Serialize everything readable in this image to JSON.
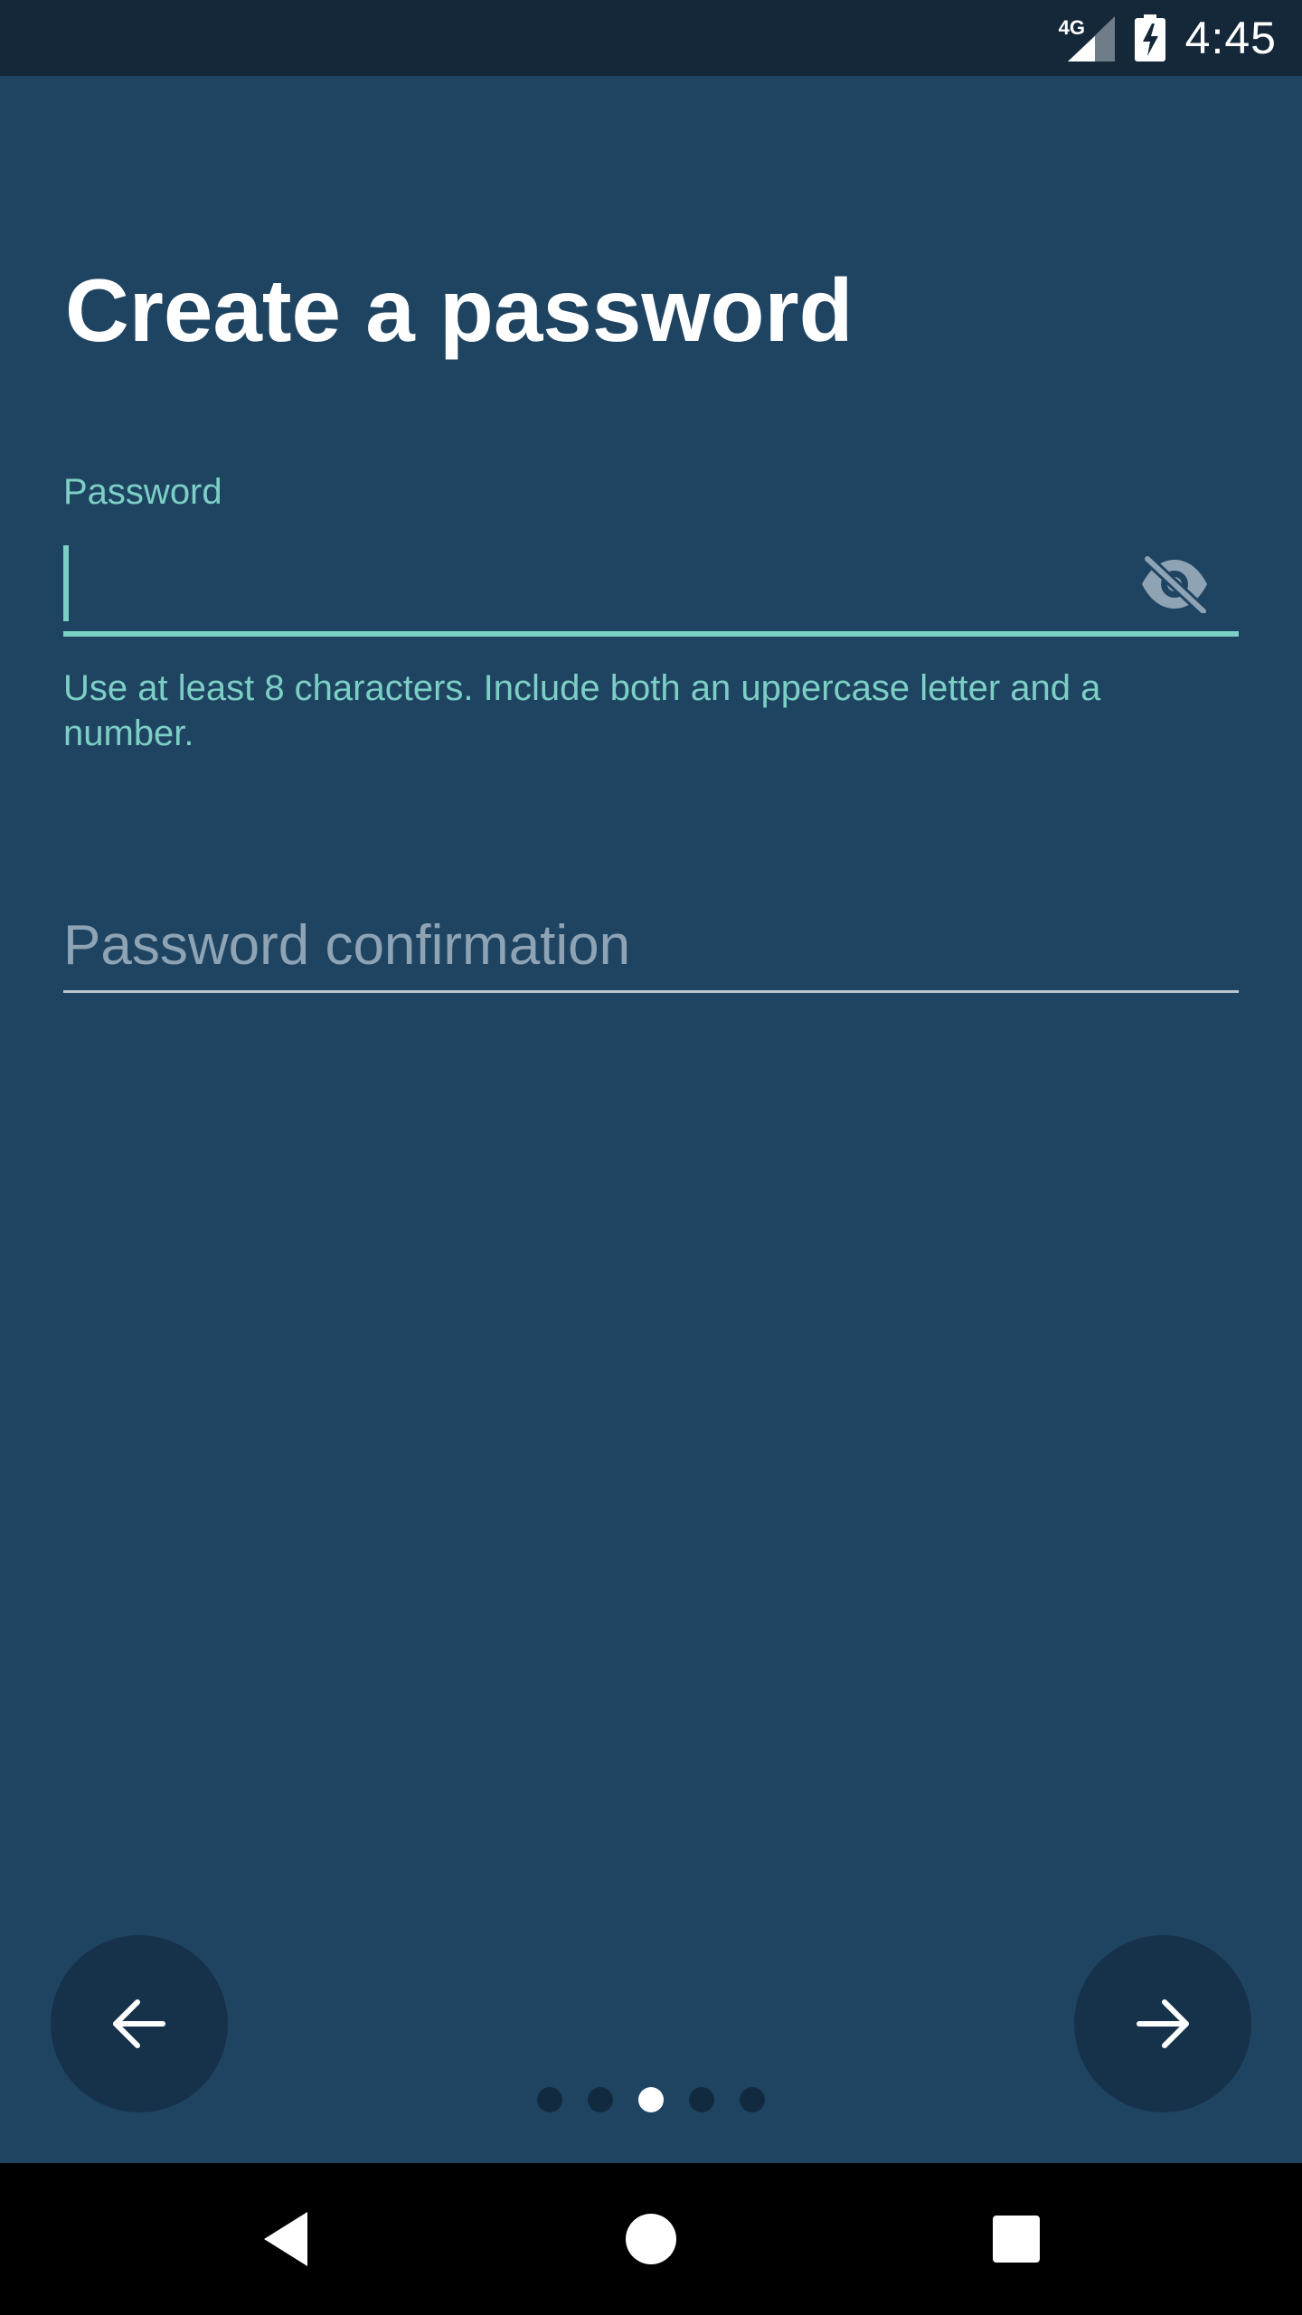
{
  "status_bar": {
    "network_type": "4G",
    "time": "4:45",
    "icons": [
      "signal-icon",
      "battery-charging-icon"
    ]
  },
  "page": {
    "title": "Create a password"
  },
  "password_field": {
    "label": "Password",
    "value": "",
    "helper_text": "Use at least 8 characters. Include both an uppercase letter and a number.",
    "toggle_icon": "visibility-off-icon"
  },
  "confirm_field": {
    "placeholder": "Password confirmation",
    "value": ""
  },
  "navigation": {
    "back_icon": "arrow-left-icon",
    "next_icon": "arrow-right-icon"
  },
  "pagination": {
    "total": 5,
    "current": 3
  },
  "system_nav": {
    "icons": [
      "back-triangle-icon",
      "home-circle-icon",
      "recents-square-icon"
    ]
  },
  "colors": {
    "background": "#1f4462",
    "status_bar": "#14283a",
    "accent": "#7ccfc4",
    "button": "#16324b",
    "dot_inactive": "#122a3f",
    "dot_active": "#ffffff"
  }
}
